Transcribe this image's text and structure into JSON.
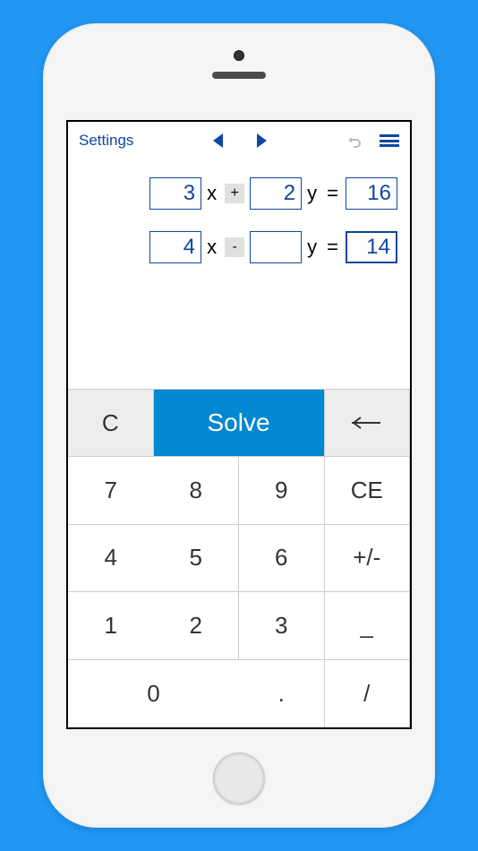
{
  "toolbar": {
    "settings": "Settings"
  },
  "equations": [
    {
      "a": "3",
      "op": "+",
      "b": "2",
      "c": "16",
      "focus": ""
    },
    {
      "a": "4",
      "op": "-",
      "b": "",
      "c": "14",
      "focus": "c"
    }
  ],
  "vars": {
    "x": "x",
    "y": "y",
    "eq": "="
  },
  "keys": {
    "c": "C",
    "solve": "Solve",
    "ce": "CE",
    "plusminus": "+/-",
    "fracbar": "_",
    "slash": "/",
    "dot": ".",
    "n0": "0",
    "n1": "1",
    "n2": "2",
    "n3": "3",
    "n4": "4",
    "n5": "5",
    "n6": "6",
    "n7": "7",
    "n8": "8",
    "n9": "9"
  }
}
